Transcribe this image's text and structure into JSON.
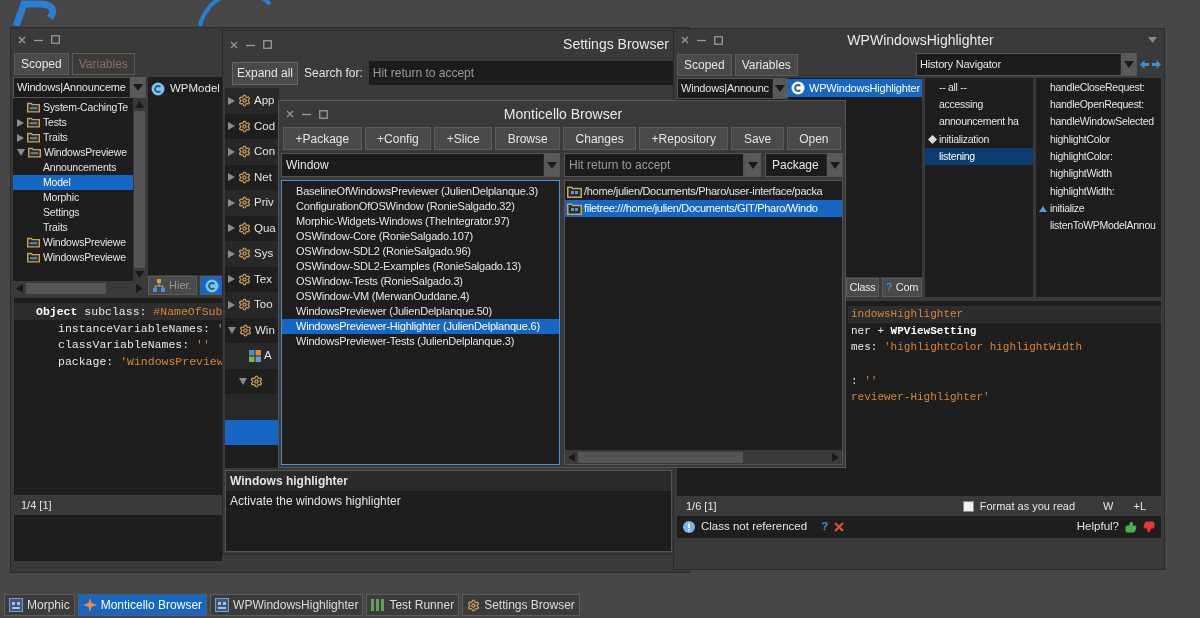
{
  "system_browser": {
    "scope_buttons": [
      {
        "label": "Scoped",
        "disabled": false
      },
      {
        "label": "Variables",
        "disabled": true
      }
    ],
    "package_filter": {
      "value": "Windows|Announceme"
    },
    "packages": [
      {
        "label": "System-CachingTe",
        "kind": "package",
        "selected": false
      },
      {
        "label": "Tests",
        "kind": "tagged",
        "expanded": false,
        "selected": false
      },
      {
        "label": "Traits",
        "kind": "tagged",
        "expanded": false,
        "selected": false
      },
      {
        "label": "WindowsPreviewe",
        "kind": "tagged",
        "expanded": true,
        "selected": false,
        "children": [
          {
            "label": "Announcements",
            "selected": false
          },
          {
            "label": "Model",
            "selected": true
          },
          {
            "label": "Morphic",
            "selected": false
          },
          {
            "label": "Settings",
            "selected": false
          },
          {
            "label": "Traits",
            "selected": false
          }
        ]
      },
      {
        "label": "WindowsPreviewe",
        "kind": "package",
        "selected": false
      },
      {
        "label": "WindowsPreviewe",
        "kind": "package",
        "selected": false
      }
    ],
    "classes": [
      {
        "name": "WPModel",
        "selected": false
      }
    ],
    "class_buttons": [
      {
        "label": "Hier.",
        "kind": "hierarchy",
        "selected": false
      },
      {
        "kind": "class",
        "selected": true
      }
    ],
    "code": [
      {
        "highlighted": true,
        "indented": false,
        "tokens": [
          {
            "text": "Object",
            "kind": "keyword"
          },
          {
            "text": " subclass: ",
            "kind": "plain"
          },
          {
            "text": "#NameOfSub",
            "kind": "literal"
          }
        ]
      },
      {
        "highlighted": false,
        "indented": true,
        "tokens": [
          {
            "text": "instanceVariableNames: ",
            "kind": "plain"
          },
          {
            "text": "'",
            "kind": "literal"
          }
        ]
      },
      {
        "highlighted": false,
        "indented": true,
        "tokens": [
          {
            "text": "classVariableNames: ",
            "kind": "plain"
          },
          {
            "text": "''",
            "kind": "literal"
          }
        ]
      },
      {
        "highlighted": false,
        "indented": true,
        "tokens": [
          {
            "text": "package: ",
            "kind": "plain"
          },
          {
            "text": "'WindowsPreview",
            "kind": "literal"
          }
        ]
      }
    ],
    "status": "1/4 [1]"
  },
  "settings_browser": {
    "title": "Settings Browser",
    "expand_button": "Expand all",
    "search_label": "Search for:",
    "search": {
      "placeholder": "Hit return to accept"
    },
    "tree": [
      {
        "label": "App",
        "kind": "group",
        "expanded": false,
        "selected": false
      },
      {
        "label": "Cod",
        "kind": "group",
        "expanded": false,
        "selected": false
      },
      {
        "label": "Con",
        "kind": "group",
        "expanded": false,
        "selected": false
      },
      {
        "label": "Net",
        "kind": "group",
        "expanded": false,
        "selected": false
      },
      {
        "label": "Priv",
        "kind": "group",
        "expanded": false,
        "selected": false
      },
      {
        "label": "Qua",
        "kind": "group",
        "expanded": false,
        "selected": false
      },
      {
        "label": "Sys",
        "kind": "group",
        "expanded": false,
        "selected": false
      },
      {
        "label": "Tex",
        "kind": "group",
        "expanded": false,
        "selected": false
      },
      {
        "label": "Too",
        "kind": "group",
        "expanded": false,
        "selected": false
      },
      {
        "label": "Win",
        "kind": "group",
        "expanded": true,
        "selected": false,
        "children": [
          {
            "label": "A",
            "kind": "setting",
            "selected": false
          },
          {
            "kind": "group",
            "expanded": true,
            "selected": false,
            "children": [
              {
                "selected": false
              },
              {
                "selected": true
              }
            ]
          }
        ]
      }
    ],
    "description": {
      "title": "Windows highlighter",
      "text": "Activate the windows highlighter"
    }
  },
  "monticello": {
    "title": "Monticello Browser",
    "buttons": [
      "+Package",
      "+Config",
      "+Slice",
      "Browse",
      "Changes",
      "+Repository",
      "Save",
      "Open"
    ],
    "package_filter": {
      "value": "Window"
    },
    "repository_filter": {
      "placeholder": "Hit return to accept"
    },
    "repository_type": {
      "value": "Package"
    },
    "packages": [
      {
        "label": "BaselineOfWindowsPreviewer (JulienDelplanque.3)",
        "selected": false
      },
      {
        "label": "ConfigurationOfOSWindow (RonieSalgado.32)",
        "selected": false
      },
      {
        "label": "Morphic-Widgets-Windows (TheIntegrator.97)",
        "selected": false
      },
      {
        "label": "OSWindow-Core (RonieSalgado.107)",
        "selected": false
      },
      {
        "label": "OSWindow-SDL2 (RonieSalgado.96)",
        "selected": false
      },
      {
        "label": "OSWindow-SDL2-Examples (RonieSalgado.13)",
        "selected": false
      },
      {
        "label": "OSWindow-Tests (RonieSalgado.3)",
        "selected": false
      },
      {
        "label": "OSWindow-VM (MerwanOuddane.4)",
        "selected": false
      },
      {
        "label": "WindowsPreviewer (JulienDelplanque.50)",
        "selected": false
      },
      {
        "label": "WindowsPreviewer-Highlighter (JulienDelplanque.6)",
        "selected": true
      },
      {
        "label": "WindowsPreviewer-Tests (JulienDelplanque.3)",
        "selected": false
      }
    ],
    "repositories": [
      {
        "label": "/home/julien/Documents/Pharo/user-interface/packa",
        "selected": false
      },
      {
        "label": "filetree:///home/julien/Documents/GIT/Pharo/Windo",
        "selected": true
      }
    ]
  },
  "class_browser": {
    "title": "WPWindowsHighlighter",
    "scope_buttons": [
      {
        "label": "Scoped",
        "disabled": false
      },
      {
        "label": "Variables",
        "disabled": false
      }
    ],
    "history": {
      "value": "History Navigator"
    },
    "package_filter": {
      "value": "Windows|Announc"
    },
    "classes": [
      {
        "name": "WPWindowsHighlighter",
        "selected": true
      }
    ],
    "class_buttons": [
      {
        "label": "Class"
      },
      {
        "glyph": "?",
        "label": "Com"
      }
    ],
    "protocols": [
      {
        "label": "-- all --",
        "selected": false
      },
      {
        "label": "accessing",
        "selected": false
      },
      {
        "label": "announcement ha",
        "selected": false
      },
      {
        "label": "initialization",
        "kind": "diamond",
        "selected": false
      },
      {
        "label": "listening",
        "selected": true
      }
    ],
    "methods": [
      {
        "label": "handleCloseRequest:",
        "selected": false
      },
      {
        "label": "handleOpenRequest:",
        "selected": false
      },
      {
        "label": "handleWindowSelected",
        "selected": false
      },
      {
        "label": "highlightColor",
        "selected": false
      },
      {
        "label": "highlightColor:",
        "selected": false
      },
      {
        "label": "highlightWidth",
        "selected": false
      },
      {
        "label": "highlightWidth:",
        "selected": false
      },
      {
        "label": "initialize",
        "kind": "triangle",
        "selected": false
      },
      {
        "label": "listenToWPModelAnnou",
        "selected": false
      }
    ],
    "code": [
      {
        "highlighted": true,
        "tokens": [
          {
            "text": "indowsHighlighter",
            "kind": "literal"
          }
        ]
      },
      {
        "highlighted": false,
        "tokens": [
          {
            "text": "ner + ",
            "kind": "plain"
          },
          {
            "text": "WPViewSetting",
            "kind": "keyword"
          }
        ]
      },
      {
        "highlighted": false,
        "tokens": [
          {
            "text": "mes: ",
            "kind": "plain"
          },
          {
            "text": "'highlightColor highlightWidth",
            "kind": "literal"
          }
        ]
      },
      {
        "blank": true
      },
      {
        "highlighted": false,
        "tokens": [
          {
            "text": ": ",
            "kind": "plain"
          },
          {
            "text": "''",
            "kind": "literal"
          }
        ]
      },
      {
        "highlighted": false,
        "tokens": [
          {
            "text": "reviewer-Highlighter'",
            "kind": "literal"
          }
        ]
      }
    ],
    "status": "1/6 [1]",
    "format_checkbox": {
      "label": "Format as you read",
      "checked": false
    },
    "status_buttons": [
      "W",
      "+L"
    ],
    "critic": {
      "message": "Class not referenced",
      "help": "?",
      "helpful_label": "Helpful?"
    }
  },
  "taskbar": [
    {
      "label": "Morphic",
      "kind": "window",
      "selected": false
    },
    {
      "label": "Monticello Browser",
      "kind": "monticello",
      "selected": true
    },
    {
      "label": "WPWindowsHighlighter",
      "kind": "window",
      "selected": false
    },
    {
      "label": "Test Runner",
      "kind": "bars",
      "selected": false
    },
    {
      "label": "Settings Browser",
      "kind": "gear",
      "selected": false
    }
  ]
}
